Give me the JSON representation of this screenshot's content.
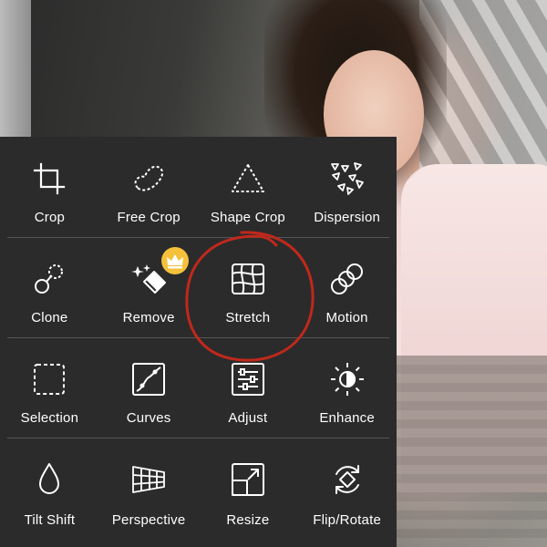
{
  "tools": [
    [
      {
        "id": "crop",
        "label": "Crop",
        "icon": "crop-icon"
      },
      {
        "id": "free-crop",
        "label": "Free Crop",
        "icon": "free-crop-icon"
      },
      {
        "id": "shape-crop",
        "label": "Shape Crop",
        "icon": "triangle-dashed-icon"
      },
      {
        "id": "dispersion",
        "label": "Dispersion",
        "icon": "dispersion-icon"
      }
    ],
    [
      {
        "id": "clone",
        "label": "Clone",
        "icon": "clone-icon"
      },
      {
        "id": "remove",
        "label": "Remove",
        "icon": "eraser-wand-icon"
      },
      {
        "id": "stretch",
        "label": "Stretch",
        "icon": "warp-grid-icon"
      },
      {
        "id": "motion",
        "label": "Motion",
        "icon": "motion-circles-icon"
      }
    ],
    [
      {
        "id": "selection",
        "label": "Selection",
        "icon": "dashed-square-icon"
      },
      {
        "id": "curves",
        "label": "Curves",
        "icon": "curves-icon"
      },
      {
        "id": "adjust",
        "label": "Adjust",
        "icon": "sliders-icon"
      },
      {
        "id": "enhance",
        "label": "Enhance",
        "icon": "contrast-sun-icon"
      }
    ],
    [
      {
        "id": "tilt-shift",
        "label": "Tilt Shift",
        "icon": "droplet-icon"
      },
      {
        "id": "perspective",
        "label": "Perspective",
        "icon": "perspective-grid-icon"
      },
      {
        "id": "resize",
        "label": "Resize",
        "icon": "resize-icon"
      },
      {
        "id": "flip-rotate",
        "label": "Flip/Rotate",
        "icon": "flip-rotate-icon"
      }
    ]
  ],
  "premium_badge": {
    "icon": "crown-icon",
    "color": "#f5c13a",
    "on_tool": "remove"
  },
  "annotation": {
    "color": "#c0281c",
    "target": "stretch"
  },
  "colors": {
    "panel_bg": "#2b2b2b",
    "text": "#ffffff",
    "divider": "#555555"
  }
}
